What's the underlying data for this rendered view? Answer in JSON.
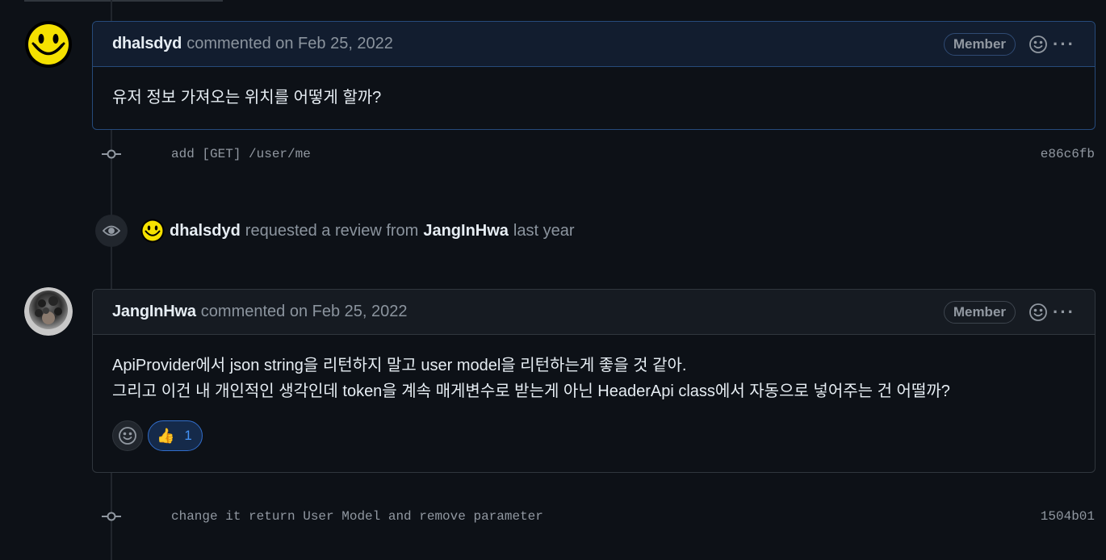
{
  "comments": [
    {
      "author": "dhalsdyd",
      "meta": "commented on Feb 25, 2022",
      "badge": "Member",
      "body": [
        "유저 정보 가져오는 위치를 어떻게 할까?"
      ]
    },
    {
      "author": "JangInHwa",
      "meta": "commented on Feb 25, 2022",
      "badge": "Member",
      "body": [
        "ApiProvider에서 json string을 리턴하지 말고 user model을 리턴하는게 좋을 것 같아.",
        "그리고 이건 내 개인적인 생각인데 token을 계속 매게변수로 받는게 아닌 HeaderApi class에서 자동으로 넣어주는 건 어떨까?"
      ],
      "reaction": {
        "emoji": "👍",
        "count": "1"
      }
    }
  ],
  "commits": [
    {
      "message": "add [GET] /user/me",
      "sha": "e86c6fb"
    },
    {
      "message": "change it return User Model and remove parameter",
      "sha": "1504b01"
    }
  ],
  "event": {
    "actor": "dhalsdyd",
    "action": "requested a review from",
    "target": "JangInHwa",
    "time": "last year"
  },
  "kebab_glyph": "···",
  "icons": {
    "comment_menu": "kebab-horizontal-icon",
    "reaction": "smiley-icon",
    "commit": "git-commit-icon",
    "review": "eye-icon"
  },
  "colors": {
    "background": "#0d1117",
    "accent": "#4493f8",
    "highlight_header": "#121d2f",
    "smiley": "#f5e100"
  }
}
